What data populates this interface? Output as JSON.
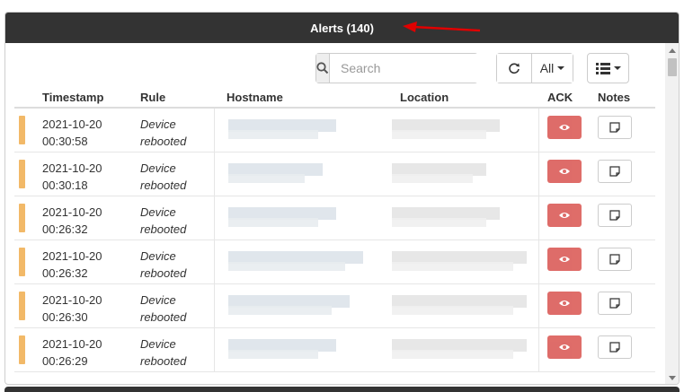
{
  "panel": {
    "title": "Alerts (140)"
  },
  "toolbar": {
    "search_placeholder": "Search",
    "filter_label": "All",
    "icons": [
      "search-icon",
      "refresh-icon",
      "caret-down-icon",
      "list-columns-icon"
    ]
  },
  "table": {
    "columns": [
      "Timestamp",
      "Rule",
      "Hostname",
      "Location",
      "ACK",
      "Notes"
    ],
    "rows": [
      {
        "date": "2021-10-20",
        "time": "00:30:58",
        "rule_line1": "Device",
        "rule_line2": "rebooted",
        "hostname": "",
        "location": ""
      },
      {
        "date": "2021-10-20",
        "time": "00:30:18",
        "rule_line1": "Device",
        "rule_line2": "rebooted",
        "hostname": "",
        "location": ""
      },
      {
        "date": "2021-10-20",
        "time": "00:26:32",
        "rule_line1": "Device",
        "rule_line2": "rebooted",
        "hostname": "",
        "location": ""
      },
      {
        "date": "2021-10-20",
        "time": "00:26:32",
        "rule_line1": "Device",
        "rule_line2": "rebooted",
        "hostname": "",
        "location": ""
      },
      {
        "date": "2021-10-20",
        "time": "00:26:30",
        "rule_line1": "Device",
        "rule_line2": "rebooted",
        "hostname": "",
        "location": ""
      },
      {
        "date": "2021-10-20",
        "time": "00:26:29",
        "rule_line1": "Device",
        "rule_line2": "rebooted",
        "hostname": "",
        "location": ""
      }
    ]
  },
  "colors": {
    "header_bg": "#333333",
    "severity_warning": "#f0ad4e",
    "ack_button": "#d9534f",
    "annotation_arrow": "#e00000"
  }
}
